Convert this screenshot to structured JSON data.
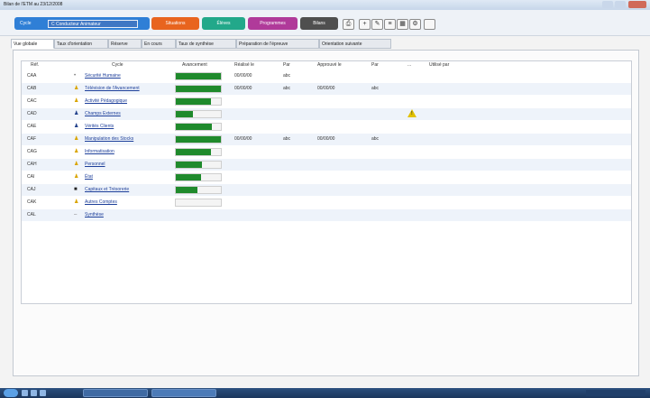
{
  "window": {
    "title": "Bilan de l'ETM au 23/12/2008"
  },
  "toolbar": {
    "buttons": [
      {
        "label": "Cycle",
        "color": "#2f7fd6"
      },
      {
        "label": "Situations",
        "color": "#e8641e"
      },
      {
        "label": "Élèves",
        "color": "#22a88a"
      },
      {
        "label": "Programmes",
        "color": "#b03a9a"
      },
      {
        "label": "Bilans",
        "color": "#4f4f4f"
      }
    ],
    "class_select": "C Conducteur Animateur",
    "icon_buttons": [
      "print-icon",
      "add-icon",
      "edit-icon",
      "list-icon",
      "grid-icon",
      "settings-icon",
      "blank-icon"
    ]
  },
  "tabs": [
    {
      "label": "Vue globale",
      "active": true
    },
    {
      "label": "Taux d'orientation",
      "active": false
    },
    {
      "label": "Réserve",
      "active": false
    },
    {
      "label": "En cours",
      "active": false
    },
    {
      "label": "Taux de synthèse",
      "active": false
    },
    {
      "label": "Préparation de l'épreuve",
      "active": false
    },
    {
      "label": "Orientation suivante",
      "active": false
    }
  ],
  "table": {
    "columns": [
      "Réf.",
      "Cycle",
      "Avancement",
      "Réalisé le",
      "Par",
      "Approuvé le",
      "Par",
      "...",
      "Utilisé par"
    ],
    "rows": [
      {
        "ref": "CAA",
        "icon": "dot-icon",
        "icon_color": "#777777",
        "cycle": "Sécurité Humaine",
        "progress": 1.0,
        "realise_le": "00/00/00",
        "par": "abc",
        "approuve_le": "",
        "par2": "",
        "warning": false
      },
      {
        "ref": "CAB",
        "icon": "figure-icon",
        "icon_color": "#d9a400",
        "cycle": "Télévision de l'Avancement",
        "progress": 1.0,
        "realise_le": "00/00/00",
        "par": "abc",
        "approuve_le": "00/00/00",
        "par2": "abc",
        "warning": false
      },
      {
        "ref": "CAC",
        "icon": "figure-icon",
        "icon_color": "#d9a400",
        "cycle": "Activité Pédagogique",
        "progress": 0.78,
        "realise_le": "",
        "par": "",
        "approuve_le": "",
        "par2": "",
        "warning": false
      },
      {
        "ref": "CAD",
        "icon": "figure-icon",
        "icon_color": "#1f3f8a",
        "cycle": "Champs Externes",
        "progress": 0.38,
        "realise_le": "",
        "par": "",
        "approuve_le": "",
        "par2": "",
        "warning": true
      },
      {
        "ref": "CAE",
        "icon": "figure-icon",
        "icon_color": "#1f3f8a",
        "cycle": "Vérités Clients",
        "progress": 0.8,
        "realise_le": "",
        "par": "",
        "approuve_le": "",
        "par2": "",
        "warning": false
      },
      {
        "ref": "CAF",
        "icon": "figure-icon",
        "icon_color": "#d9a400",
        "cycle": "Manipulation des Stocks",
        "progress": 1.0,
        "realise_le": "00/00/00",
        "par": "abc",
        "approuve_le": "00/00/00",
        "par2": "abc",
        "warning": false
      },
      {
        "ref": "CAG",
        "icon": "figure-icon",
        "icon_color": "#d9a400",
        "cycle": "Informatisation",
        "progress": 0.78,
        "realise_le": "",
        "par": "",
        "approuve_le": "",
        "par2": "",
        "warning": false
      },
      {
        "ref": "CAH",
        "icon": "figure-icon",
        "icon_color": "#d9a400",
        "cycle": "Personnel",
        "progress": 0.58,
        "realise_le": "",
        "par": "",
        "approuve_le": "",
        "par2": "",
        "warning": false
      },
      {
        "ref": "CAI",
        "icon": "figure-icon",
        "icon_color": "#d9a400",
        "cycle": "État",
        "progress": 0.55,
        "realise_le": "",
        "par": "",
        "approuve_le": "",
        "par2": "",
        "warning": false
      },
      {
        "ref": "CAJ",
        "icon": "briefcase-icon",
        "icon_color": "#222222",
        "cycle": "Capitaux et Trésorerie",
        "progress": 0.48,
        "realise_le": "",
        "par": "",
        "approuve_le": "",
        "par2": "",
        "warning": false
      },
      {
        "ref": "CAK",
        "icon": "figure-icon",
        "icon_color": "#d9a400",
        "cycle": "Autres Comptes",
        "progress": 0.0,
        "realise_le": "",
        "par": "",
        "approuve_le": "",
        "par2": "",
        "warning": false
      },
      {
        "ref": "CAL",
        "icon": "dash-icon",
        "icon_color": "#777777",
        "cycle": "Synthèse",
        "progress": null,
        "realise_le": "",
        "par": "",
        "approuve_le": "",
        "par2": "",
        "warning": false
      }
    ]
  }
}
